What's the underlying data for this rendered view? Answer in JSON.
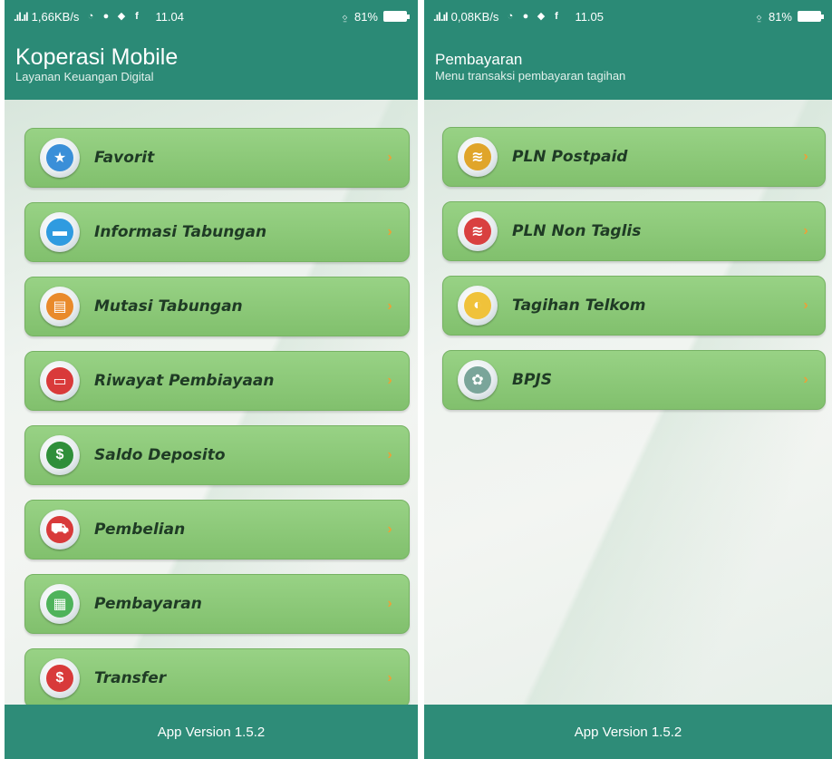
{
  "left": {
    "status": {
      "signal": ".ıl.ıl",
      "speed": "1,66KB/s",
      "time": "11.04",
      "battery": "81%"
    },
    "title": "Koperasi Mobile",
    "subtitle": "Layanan Keuangan Digital",
    "menu": [
      {
        "label": "Favorit",
        "icon": "star-icon",
        "color": "#3a8fd8",
        "glyph": "★"
      },
      {
        "label": "Informasi Tabungan",
        "icon": "wallet-icon",
        "color": "#2f9be0",
        "glyph": "▬"
      },
      {
        "label": "Mutasi Tabungan",
        "icon": "document-icon",
        "color": "#e98a2b",
        "glyph": "▤"
      },
      {
        "label": "Riwayat Pembiayaan",
        "icon": "credit-card-icon",
        "color": "#d93a3a",
        "glyph": "▭"
      },
      {
        "label": "Saldo Deposito",
        "icon": "money-bag-icon",
        "color": "#2f8f3a",
        "glyph": "$"
      },
      {
        "label": "Pembelian",
        "icon": "shopping-cart-icon",
        "color": "#d83a3a",
        "glyph": "⛟"
      },
      {
        "label": "Pembayaran",
        "icon": "calculator-icon",
        "color": "#4fb35b",
        "glyph": "▦"
      },
      {
        "label": "Transfer",
        "icon": "money-bag-transfer-icon",
        "color": "#d83a3a",
        "glyph": "$"
      }
    ],
    "footer": "App Version 1.5.2"
  },
  "right": {
    "status": {
      "signal": ".ıl.ıl",
      "speed": "0,08KB/s",
      "time": "11.05",
      "battery": "81%"
    },
    "title": "Pembayaran",
    "subtitle": "Menu transaksi pembayaran tagihan",
    "menu": [
      {
        "label": "PLN Postpaid",
        "icon": "pln-logo-icon",
        "color": "#e0a52a",
        "glyph": "≋"
      },
      {
        "label": "PLN Non Taglis",
        "icon": "pln-logo-icon",
        "color": "#d94040",
        "glyph": "≋"
      },
      {
        "label": "Tagihan Telkom",
        "icon": "telkom-logo-icon",
        "color": "#f0c23a",
        "glyph": "◐"
      },
      {
        "label": "BPJS",
        "icon": "bpjs-logo-icon",
        "color": "#7aa59a",
        "glyph": "✿"
      }
    ],
    "footer": "App Version 1.5.2"
  },
  "chevron": "›",
  "colors": {
    "header": "#2b8a76",
    "item": "#8cc978",
    "label": "#1f3b25",
    "chevron": "#e8a23a"
  }
}
